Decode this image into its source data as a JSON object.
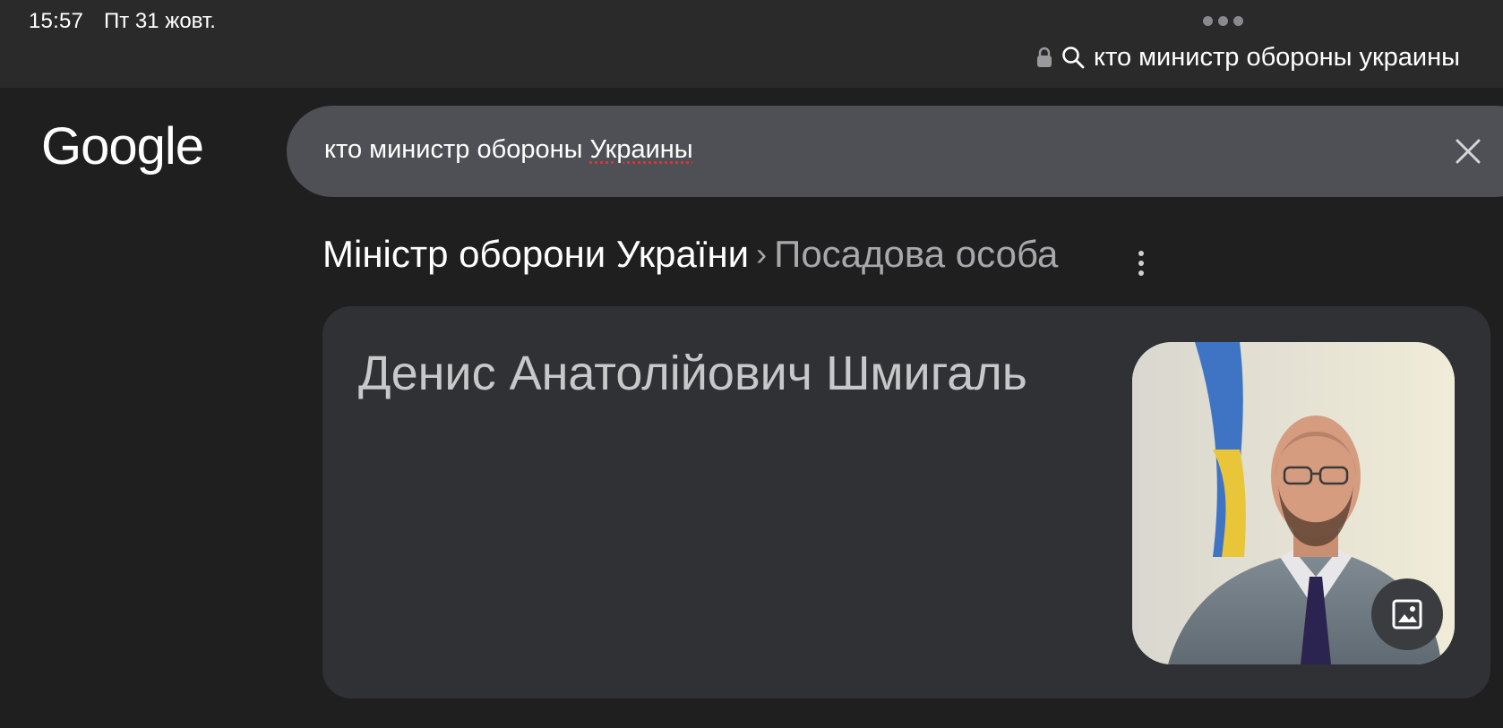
{
  "status_bar": {
    "time": "15:57",
    "date": "Пт 31 жовт."
  },
  "url_bar": {
    "query_text": "кто министр обороны украины",
    "icons": [
      "lock-icon",
      "search-icon"
    ]
  },
  "search": {
    "logo_text": "Google",
    "query_prefix": "кто министр обороны ",
    "query_misspelled_word": "Украины",
    "clear_icon": "close-icon"
  },
  "knowledge_panel": {
    "breadcrumb_main": "Міністр оборони України",
    "breadcrumb_separator": "›",
    "breadcrumb_sub": "Посадова особа",
    "more_icon": "more-vert-icon",
    "person_name": "Денис Анатолійович Шмигаль",
    "image_button_icon": "image-icon"
  },
  "colors": {
    "background": "#1f1f20",
    "statusbar": "#2a2a2b",
    "searchbox": "#4e5055",
    "card": "#303134",
    "muted_text": "#a8a8ab"
  }
}
